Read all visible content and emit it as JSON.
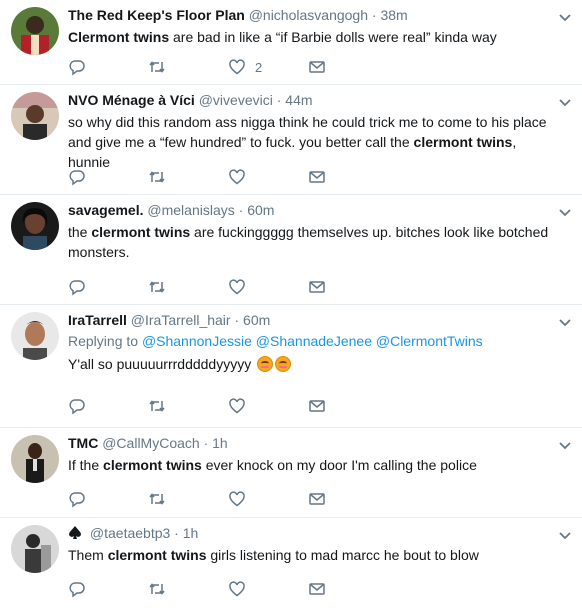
{
  "tweets": [
    {
      "fullname": "The Red Keep's Floor Plan",
      "username": "@nicholasvangogh",
      "sep": "·",
      "time": "38m",
      "text_parts": [
        "",
        "Clermont twins",
        " are bad in like a “if Barbie dolls were real” kinda way"
      ],
      "like_count": "2"
    },
    {
      "fullname": "NVO Ménage à Víci",
      "username": "@vivevevici",
      "sep": "·",
      "time": "44m",
      "text_parts": [
        "so why did this random ass nigga think he could trick me to come to his place and give me a “few hundred” to fuck. you better call the ",
        "clermont twins",
        ", hunnie"
      ],
      "like_count": ""
    },
    {
      "fullname": "savagemel.",
      "username": "@melanislays",
      "sep": "·",
      "time": "60m",
      "text_parts": [
        "the ",
        "clermont twins",
        " are fuckinggggg themselves up. bitches look like botched monsters."
      ],
      "like_count": ""
    },
    {
      "fullname": "IraTarrell",
      "username": "@IraTarrell_hair",
      "sep": "·",
      "time": "60m",
      "replying_prefix": "Replying to",
      "replying_mentions": [
        "@ShannonJessie",
        "@ShannadeJenee",
        "@ClermontTwins"
      ],
      "text_parts": [
        "Y'all so puuuuurrrdddddyyyyy",
        "",
        ""
      ],
      "like_count": ""
    },
    {
      "fullname": "TMC",
      "username": "@CallMyCoach",
      "sep": "·",
      "time": "1h",
      "text_parts": [
        "If the ",
        "clermont twins",
        " ever knock on my door I'm calling the police"
      ],
      "like_count": ""
    },
    {
      "fullname": "",
      "username": "@taetaebtp3",
      "sep": "·",
      "time": "1h",
      "text_parts": [
        "Them ",
        "clermont twins",
        " girls listening to mad marcc he bout to blow"
      ],
      "like_count": ""
    }
  ]
}
